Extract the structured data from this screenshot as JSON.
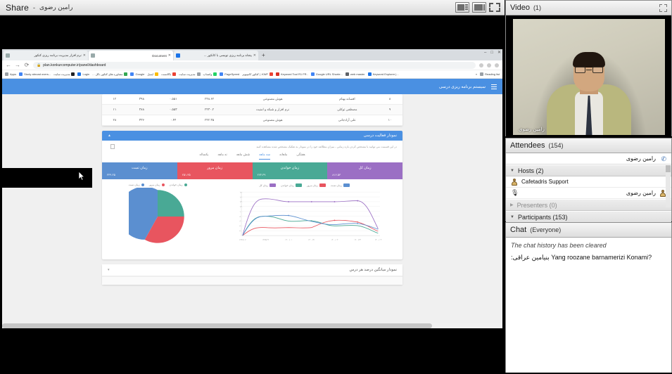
{
  "share": {
    "title": "Share",
    "dash": "-",
    "presenter": "رامین رضوی",
    "layout_button_1": "layout-filmstrip",
    "layout_button_2": "layout-single",
    "fullscreen": "fullscreen"
  },
  "browser": {
    "tabs": [
      {
        "label": "نرم افزار مدیریت برنامه ریزی کنکور",
        "close": "✕",
        "active": false
      },
      {
        "label": "Document",
        "close": "✕",
        "active": true
      },
      {
        "label": "پنجاه برنامه ریزی نویسی با کانکور ...",
        "close": "✕",
        "active": false
      }
    ],
    "new_tab": "+",
    "back": "←",
    "forward": "→",
    "reload": "⟳",
    "lock": "🔒",
    "url": "plan.konkurcomputer.ir/panel/dashboard",
    "bookmarks": [
      {
        "label": "Apps",
        "color": "#9aa0a6"
      },
      {
        "label": "Study abroad overs...",
        "color": "#4285f4"
      },
      {
        "label": "مدیریت سایت",
        "color": "#202124"
      },
      {
        "label": "Login",
        "color": "#1a73e8"
      },
      {
        "label": "مشاوره های کنکور دکل ...",
        "color": "#34a853"
      },
      {
        "label": "Google",
        "color": "#4285f4"
      },
      {
        "label": "ایمیل",
        "color": "#fbbc04"
      },
      {
        "label": "باکانست",
        "color": "#ea4335"
      },
      {
        "label": "مدیریت سایت",
        "color": "#9aa0a6"
      },
      {
        "label": "واتساپ",
        "color": "#25d366"
      },
      {
        "label": "PageSpeed",
        "color": "#4285f4"
      },
      {
        "label": "KWF. | کنکور کامپیوتر",
        "color": "#ea4335"
      },
      {
        "label": "Keyword Tool R1 FR..",
        "color": "#d93025"
      },
      {
        "label": "Google URL Shorte...",
        "color": "#4285f4"
      },
      {
        "label": "web master",
        "color": "#5f6368"
      },
      {
        "label": "Keyword Explorer |...",
        "color": "#1a73e8"
      }
    ],
    "overflow": "»",
    "reading_list": "Reading list",
    "window_controls": [
      "–",
      "□",
      "✕"
    ]
  },
  "dashboard": {
    "brand": "سیستم برنامه ریزی درسی",
    "menu_icon": "hamburger-icon",
    "table": {
      "rows": [
        [
          "۸",
          "افسانه بهنام",
          "هوش مصنوعی",
          "۲۴۸.۶۲",
          "۰.۵۵۱",
          "۳۹۸",
          "۱۲"
        ],
        [
          "۹",
          "مصطفی توکلی",
          "نرم افزار و شبکه و امنیت",
          "۲۴۳۰.۲",
          "۰.۵۵۳",
          "۳۸۸",
          "۱۱"
        ],
        [
          "۱۰",
          "علی آزادجانی",
          "هوش مصنوعی",
          "۲۴۲.۳۵",
          "۰.۴۴",
          "۳۳۶",
          "۲۸"
        ]
      ]
    },
    "activity_card": {
      "title": "نمودار فعالیت درسی",
      "caret": "▲",
      "note": "در این قسمت می توانید با مشخص کردن بازه زمانی ، میزان مطالعه خود را در نمودار به تفکیک مشخص شده مشاهده کنید",
      "tabs": [
        {
          "label": "هفتگی",
          "active": false
        },
        {
          "label": "ماهانه",
          "active": false
        },
        {
          "label": "سه ماهه",
          "active": true
        },
        {
          "label": "شش ماهه",
          "active": false
        },
        {
          "label": "نه ماهه",
          "active": false
        },
        {
          "label": "یکساله",
          "active": false
        }
      ],
      "stats": [
        {
          "label": "زمان کل",
          "value": "۸۱۶.۵۳",
          "color": "#9b6fc4"
        },
        {
          "label": "زمان خواندن",
          "value": "۲۲۴.۳۹",
          "color": "#49a995"
        },
        {
          "label": "زمان مرور",
          "value": "۲۵۱.۳۵",
          "color": "#e8555f"
        },
        {
          "label": "زمان تست",
          "value": "۳۳۹.۳۵",
          "color": "#5b8fd0"
        }
      ]
    },
    "bottom_card": {
      "title": "نمودار میانگین درصد هر درس",
      "caret": "▾"
    }
  },
  "chart_data": [
    {
      "type": "line",
      "title": "نمودار فعالیت درسی",
      "x": [
        "۱۳۹۹/۰۷",
        "۱۳۹۹/۲۲",
        "۱۴۰۰/۰۱",
        "۱۴۰۰/۲۱",
        "۱۴۰۰/۰۳",
        "۱۴۰۰/۲۳",
        "۱۴۰۰/۰۴"
      ],
      "ylim": [
        0,
        180
      ],
      "yticks": [
        "۰",
        "۲۰",
        "۴۰",
        "۶۰",
        "۸۰",
        "۱۰۰",
        "۱۲۰",
        "۱۴۰",
        "۱۶۰",
        "۱۸۰"
      ],
      "grid": true,
      "legend_position": "top",
      "series": [
        {
          "name": "زمان کل",
          "color": "#9b6fc4",
          "values": [
            0,
            152,
            140,
            140,
            140,
            144,
            28
          ]
        },
        {
          "name": "زمان خواندن",
          "color": "#49a995",
          "values": [
            0,
            36,
            30,
            60,
            45,
            40,
            10
          ]
        },
        {
          "name": "زمان مرور",
          "color": "#e8555f",
          "values": [
            0,
            33,
            33,
            33,
            63,
            56,
            18
          ]
        },
        {
          "name": "زمان تست",
          "color": "#5b8fd0",
          "values": [
            0,
            80,
            83,
            59,
            44,
            50,
            26
          ]
        }
      ]
    },
    {
      "type": "pie",
      "labels": [
        "زمان خواندن",
        "زمان مرور",
        "زمان تست"
      ],
      "values": [
        25,
        33,
        42
      ],
      "colors": [
        "#49a995",
        "#e8555f",
        "#5b8fd0"
      ],
      "legend_position": "top"
    }
  ],
  "video": {
    "title": "Video",
    "count": "(1)",
    "name": "رامین رضوی",
    "expand_icon": "expand-icon"
  },
  "attendees": {
    "title": "Attendees",
    "count": "(154)",
    "self": "رامین رضوی",
    "groups": [
      {
        "caret": "▼",
        "label": "Hosts (2)",
        "muted": false
      },
      {
        "caret": "▶",
        "label": "Presenters (0)",
        "muted": true
      },
      {
        "caret": "▼",
        "label": "Participants (153)",
        "muted": false
      }
    ],
    "hosts": [
      {
        "name": "Cafetadris Support",
        "rtl": false,
        "mic": false
      },
      {
        "name": "رامین رضوی",
        "rtl": true,
        "mic": true
      }
    ]
  },
  "chat": {
    "title": "Chat",
    "scope": "(Everyone)",
    "cleared": "The chat history has been cleared",
    "messages": [
      {
        "sender": "بنیامین عراقی:",
        "text": "Yang roozane barnamerizi Konami?"
      }
    ]
  }
}
